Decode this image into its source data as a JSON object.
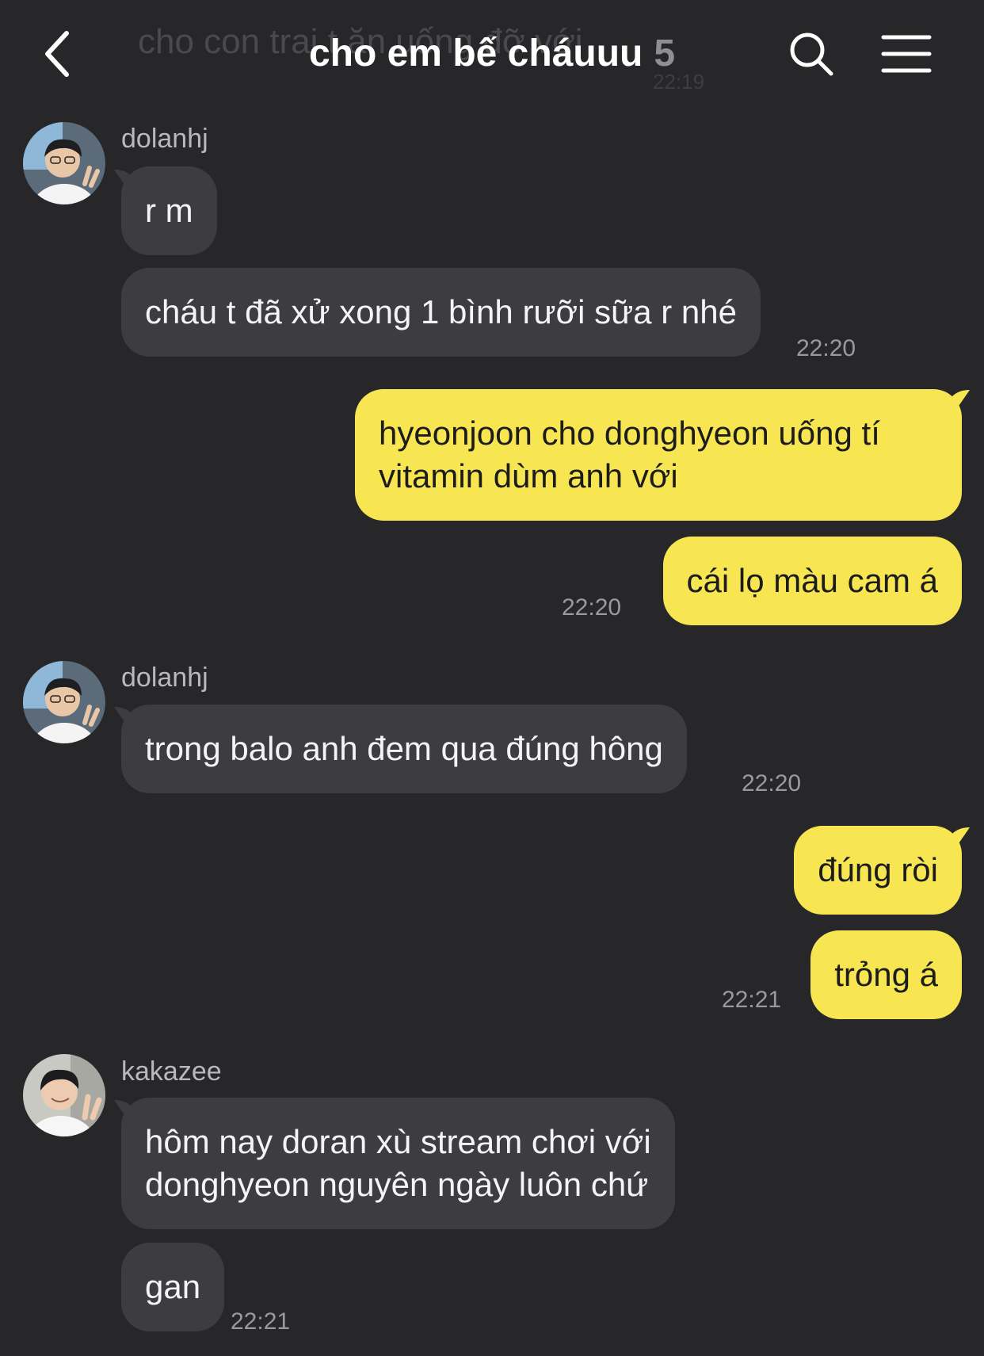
{
  "header": {
    "title": "cho em bế cháuuu",
    "member_count": "5",
    "ghost_preview_text": "cho con trai t ăn uống đỡ với",
    "ghost_preview_time": "22:19",
    "back_icon": "chevron-left-icon",
    "search_icon": "search-icon",
    "menu_icon": "hamburger-menu-icon"
  },
  "messages": [
    {
      "sender": "dolanhj",
      "text": "r m"
    },
    {
      "text": "cháu t đã xử xong 1 bình rưỡi sữa r nhé",
      "time": "22:20"
    },
    {
      "line1": "hyeonjoon cho donghyeon uống tí",
      "line2": "vitamin dùm anh với"
    },
    {
      "text": "cái lọ màu cam á",
      "time": "22:20"
    },
    {
      "sender": "dolanhj",
      "text": "trong balo anh đem qua đúng hông",
      "time": "22:20"
    },
    {
      "text": "đúng ròi"
    },
    {
      "text": "trỏng á",
      "time": "22:21"
    },
    {
      "sender": "kakazee",
      "line1": "hôm nay doran xù stream chơi với",
      "line2": "donghyeon nguyên ngày luôn chứ"
    },
    {
      "text": "gan",
      "time": "22:21"
    }
  ],
  "colors": {
    "background": "#27272a",
    "incoming_bubble": "#3d3d41",
    "outgoing_bubble": "#f7e652"
  }
}
